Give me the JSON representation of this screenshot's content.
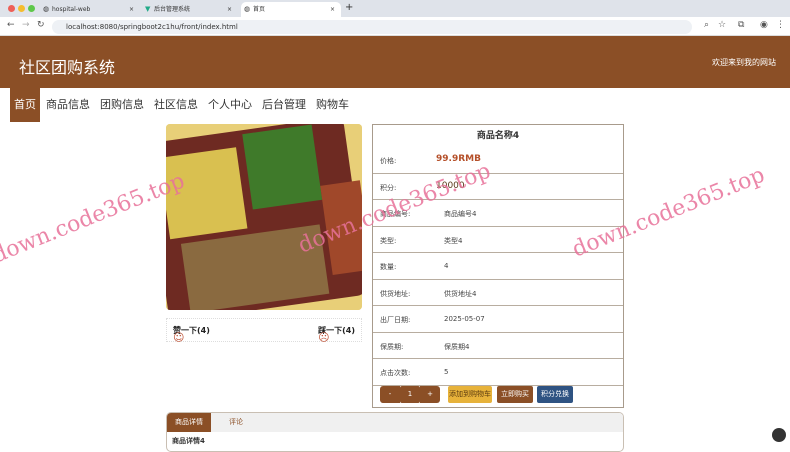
{
  "browser": {
    "tabs": [
      {
        "label": "hospital-web"
      },
      {
        "label": "后台管理系统"
      },
      {
        "label": "首页"
      }
    ],
    "url": "localhost:8080/springboot2c1hu/front/index.html"
  },
  "header": {
    "title": "社区团购系统",
    "welcome": "欢迎来到我的网站"
  },
  "nav": [
    "首页",
    "商品信息",
    "团购信息",
    "社区信息",
    "个人中心",
    "后台管理",
    "购物车"
  ],
  "product": {
    "name": "商品名称4",
    "rows": [
      {
        "k": "价格:",
        "v": "99.9RMB"
      },
      {
        "k": "积分:",
        "v": "10000"
      },
      {
        "k": "商品编号:",
        "v": "商品编号4"
      },
      {
        "k": "类型:",
        "v": "类型4"
      },
      {
        "k": "数量:",
        "v": "4"
      },
      {
        "k": "供货地址:",
        "v": "供货地址4"
      },
      {
        "k": "出厂日期:",
        "v": "2025-05-07"
      },
      {
        "k": "保质期:",
        "v": "保质期4"
      },
      {
        "k": "点击次数:",
        "v": "5"
      }
    ],
    "qty": {
      "minus": "-",
      "value": "1",
      "plus": "+"
    },
    "buttons": {
      "cart": "添加到购物车",
      "buy": "立即购买",
      "exchange": "积分兑换"
    },
    "like": "赞一下(4)",
    "dislike": "踩一下(4)"
  },
  "tabs": {
    "detail": "商品详情",
    "comment": "评论",
    "content": "商品详情4"
  },
  "watermark": "down.code365.top",
  "colors": {
    "brand": "#8b4f26",
    "cart": "#e7b23a",
    "buy": "#8b4f26",
    "exchange": "#2f5382"
  }
}
